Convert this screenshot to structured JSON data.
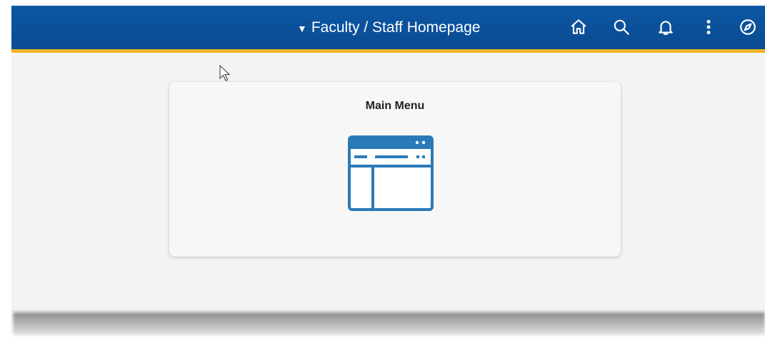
{
  "header": {
    "title": "Faculty / Staff Homepage",
    "title_caret": "▼",
    "actions": [
      {
        "name": "home-icon"
      },
      {
        "name": "search-icon"
      },
      {
        "name": "bell-icon"
      },
      {
        "name": "more-vertical-icon"
      },
      {
        "name": "navbar-compass-icon"
      }
    ]
  },
  "tile": {
    "title": "Main Menu",
    "icon": "window-browser-icon"
  },
  "colors": {
    "banner": "#0a4b91",
    "banner_accent": "#f0b323",
    "tile_icon": "#2b7ab8"
  }
}
